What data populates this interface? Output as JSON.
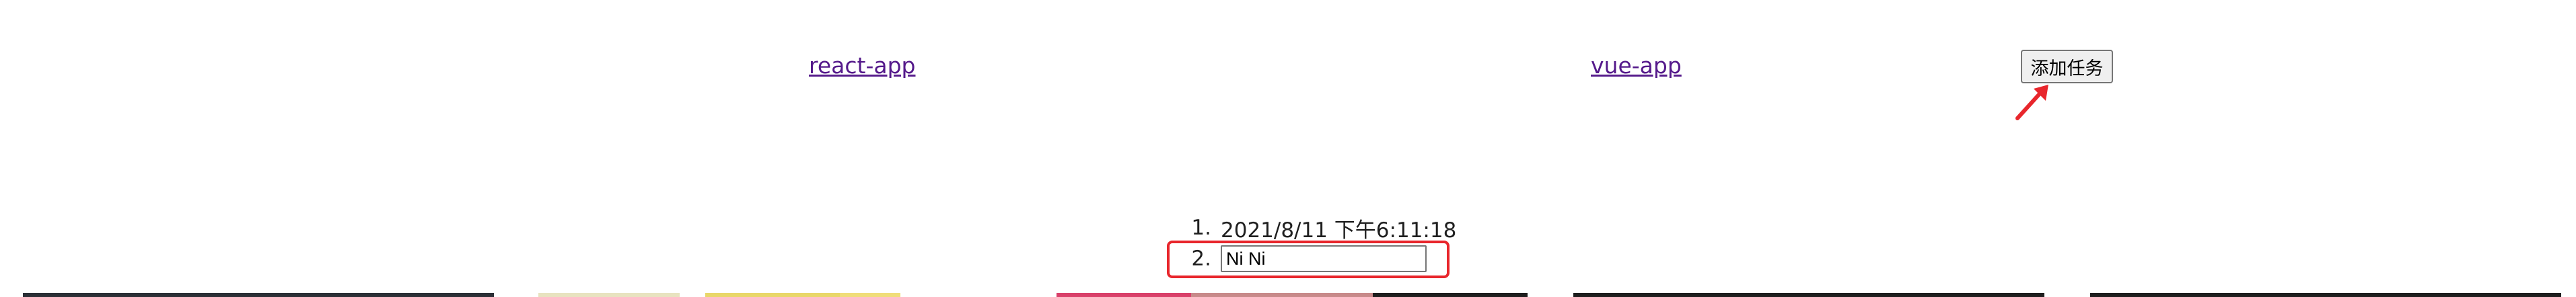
{
  "nav": {
    "react_link": "react-app",
    "vue_link": "vue-app"
  },
  "toolbar": {
    "add_task_label": "添加任务"
  },
  "tasks": {
    "items": [
      {
        "index": "1.",
        "text": "2021/8/11 下午6:11:18"
      },
      {
        "index": "2.",
        "input_value": "Ni Ni"
      }
    ]
  },
  "annotations": {
    "highlight_color": "#e8262c",
    "arrow_icon": "red-arrow-pointing-up-right"
  },
  "colors": {
    "link": "#551a8b",
    "button_bg": "#efefef",
    "button_border": "#767676"
  }
}
